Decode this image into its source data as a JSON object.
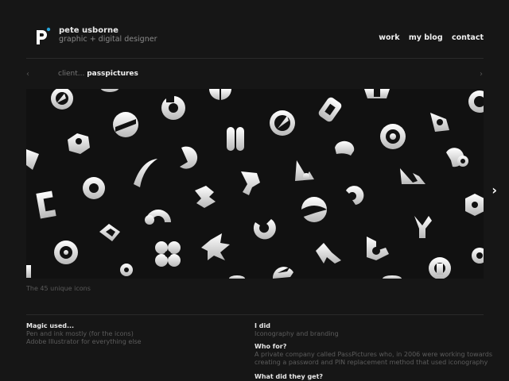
{
  "header": {
    "name": "pete usborne",
    "role": "graphic + digital designer",
    "nav": [
      "work",
      "my blog",
      "contact"
    ]
  },
  "project": {
    "label": "client...",
    "client": "passpictures",
    "prev_arrow": "‹",
    "next_arrow": "›",
    "next_big": "›"
  },
  "caption": "The 45 unique icons",
  "left_column": {
    "heading": "Magic used...",
    "line1": "Pen and ink mostly (for the icons)",
    "line2": "Adobe Illustrator for everything else"
  },
  "right_column": {
    "heading1": "I did",
    "text1": "Iconography and branding",
    "heading2": "Who for?",
    "text2a": "A private company called PassPictures who, in 2006 were working towards",
    "text2b": "creating a password and PIN replacement method that used iconography",
    "heading3": "What did they get?"
  },
  "colors": {
    "bg": "#161616",
    "accent": "#27a3d8",
    "icon": "#e6e6e6"
  }
}
